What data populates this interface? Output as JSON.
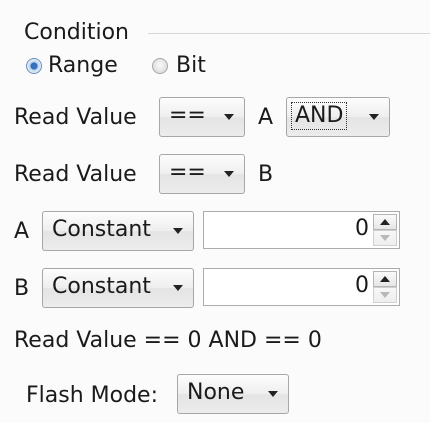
{
  "condition": {
    "title": "Condition",
    "mode_options": [
      {
        "label": "Range",
        "selected": true
      },
      {
        "label": "Bit",
        "selected": false
      }
    ]
  },
  "row1": {
    "label": "Read Value",
    "operator": "==",
    "operand": "A",
    "logic": "AND"
  },
  "row2": {
    "label": "Read Value",
    "operator": "==",
    "operand": "B"
  },
  "a_row": {
    "label": "A",
    "source": "Constant",
    "value": "0"
  },
  "b_row": {
    "label": "B",
    "source": "Constant",
    "value": "0"
  },
  "summary": "Read Value == 0 AND == 0",
  "flash": {
    "label": "Flash Mode:",
    "value": "None"
  },
  "colors": {
    "radio_selected": "#2f6ab7",
    "panel_background": "#fbfbfb",
    "border": "#a7a7a7"
  }
}
